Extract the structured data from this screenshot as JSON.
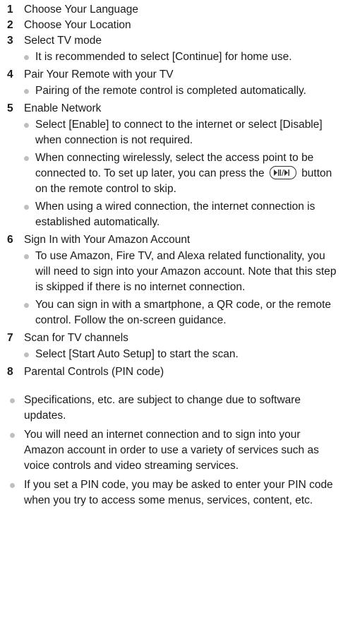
{
  "steps": [
    {
      "num": "1",
      "title": "Choose Your Language",
      "bullets": []
    },
    {
      "num": "2",
      "title": "Choose Your Location",
      "bullets": []
    },
    {
      "num": "3",
      "title": "Select TV mode",
      "bullets": [
        "It is recommended to select [Continue] for home use."
      ]
    },
    {
      "num": "4",
      "title": "Pair Your Remote with your TV",
      "bullets": [
        "Pairing of the remote control is completed automatically."
      ]
    },
    {
      "num": "5",
      "title": "Enable Network",
      "bullets": [
        "Select [Enable] to connect to the internet or select [Disable] when connection is not required.",
        "When using a wired connection, the internet connection is established automatically."
      ],
      "remote_bullet": {
        "before": "When connecting wirelessly, select the access point to be connected to. To set up later, you can press the",
        "after": "button on the remote control to skip.",
        "icon": "play-pause-skip-icon"
      }
    },
    {
      "num": "6",
      "title": "Sign In with Your Amazon Account",
      "bullets": [
        "To use Amazon, Fire TV, and Alexa related functionality, you will need to sign into your Amazon account. Note that this step is skipped if there is no internet connection.",
        "You can sign in with a smartphone, a QR code, or the remote control. Follow the on-screen guidance."
      ]
    },
    {
      "num": "7",
      "title": "Scan for TV channels",
      "bullets": [
        "Select [Start Auto Setup] to start the scan."
      ]
    },
    {
      "num": "8",
      "title": "Parental Controls (PIN code)",
      "bullets": []
    }
  ],
  "notes": [
    "Specifications, etc. are subject to change due to software updates.",
    "You will need an internet connection and to sign into your Amazon account in order to use a variety of services such as voice controls and video streaming services.",
    "If you set a PIN code, you may be asked to enter your PIN code when you try to access some menus, services, content, etc."
  ],
  "colors": {
    "text": "#1a1a1a",
    "bullet_dot": "#bfbfbf"
  }
}
